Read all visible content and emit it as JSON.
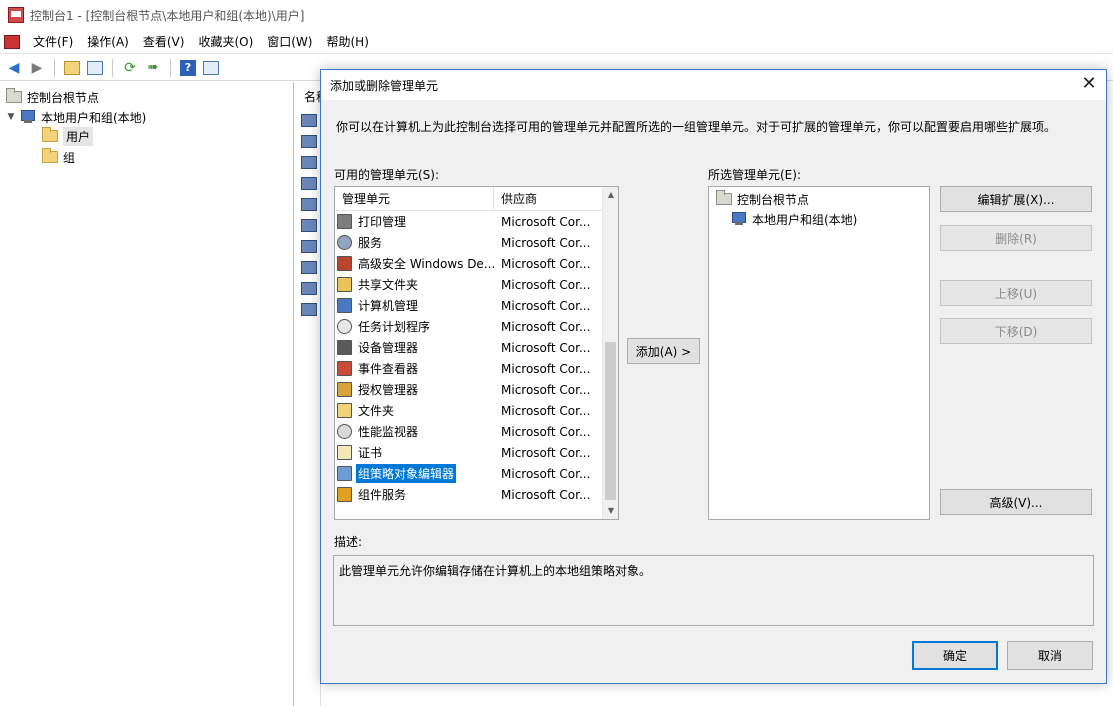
{
  "window": {
    "title": "控制台1 - [控制台根节点\\本地用户和组(本地)\\用户]"
  },
  "menu": {
    "items": [
      "文件(F)",
      "操作(A)",
      "查看(V)",
      "收藏夹(O)",
      "窗口(W)",
      "帮助(H)"
    ]
  },
  "toolbar": {
    "icons": [
      "back-icon",
      "forward-icon",
      "up-folder-icon",
      "show-hide-tree-icon",
      "refresh-icon",
      "export-list-icon",
      "help-icon",
      "show-hide-action-pane-icon"
    ]
  },
  "tree": {
    "root": "控制台根节点",
    "snapin": "本地用户和组(本地)",
    "users": "用户",
    "groups": "组"
  },
  "center": {
    "column_header": "名称"
  },
  "dialog": {
    "title": "添加或删除管理单元",
    "intro": "你可以在计算机上为此控制台选择可用的管理单元并配置所选的一组管理单元。对于可扩展的管理单元，你可以配置要启用哪些扩展项。",
    "available_label": "可用的管理单元(S):",
    "selected_label": "所选管理单元(E):",
    "columns": {
      "name": "管理单元",
      "vendor": "供应商"
    },
    "available": [
      {
        "name": "打印管理",
        "vendor": "Microsoft Cor...",
        "icon": "printer-icon"
      },
      {
        "name": "服务",
        "vendor": "Microsoft Cor...",
        "icon": "gear-icon"
      },
      {
        "name": "高级安全 Windows De...",
        "vendor": "Microsoft Cor...",
        "icon": "firewall-icon"
      },
      {
        "name": "共享文件夹",
        "vendor": "Microsoft Cor...",
        "icon": "shared-folder-icon"
      },
      {
        "name": "计算机管理",
        "vendor": "Microsoft Cor...",
        "icon": "computer-management-icon"
      },
      {
        "name": "任务计划程序",
        "vendor": "Microsoft Cor...",
        "icon": "clock-icon"
      },
      {
        "name": "设备管理器",
        "vendor": "Microsoft Cor...",
        "icon": "device-icon"
      },
      {
        "name": "事件查看器",
        "vendor": "Microsoft Cor...",
        "icon": "event-log-icon"
      },
      {
        "name": "授权管理器",
        "vendor": "Microsoft Cor...",
        "icon": "authorization-icon"
      },
      {
        "name": "文件夹",
        "vendor": "Microsoft Cor...",
        "icon": "folder-icon"
      },
      {
        "name": "性能监视器",
        "vendor": "Microsoft Cor...",
        "icon": "performance-icon"
      },
      {
        "name": "证书",
        "vendor": "Microsoft Cor...",
        "icon": "certificate-icon"
      },
      {
        "name": "组策略对象编辑器",
        "vendor": "Microsoft Cor...",
        "icon": "policy-icon"
      },
      {
        "name": "组件服务",
        "vendor": "Microsoft Cor...",
        "icon": "component-services-icon"
      }
    ],
    "selected_index": 12,
    "add_button": "添加(A) >",
    "selected": {
      "root": "控制台根节点",
      "child": "本地用户和组(本地)"
    },
    "buttons": {
      "edit_extensions": "编辑扩展(X)...",
      "remove": "删除(R)",
      "move_up": "上移(U)",
      "move_down": "下移(D)",
      "advanced": "高级(V)..."
    },
    "description_label": "描述:",
    "description": "此管理单元允许你编辑存储在计算机上的本地组策略对象。",
    "ok": "确定",
    "cancel": "取消"
  },
  "colors": {
    "selection": "#0078d7",
    "dialog_border": "#3c78c4",
    "button_face": "#e1e1e1"
  }
}
